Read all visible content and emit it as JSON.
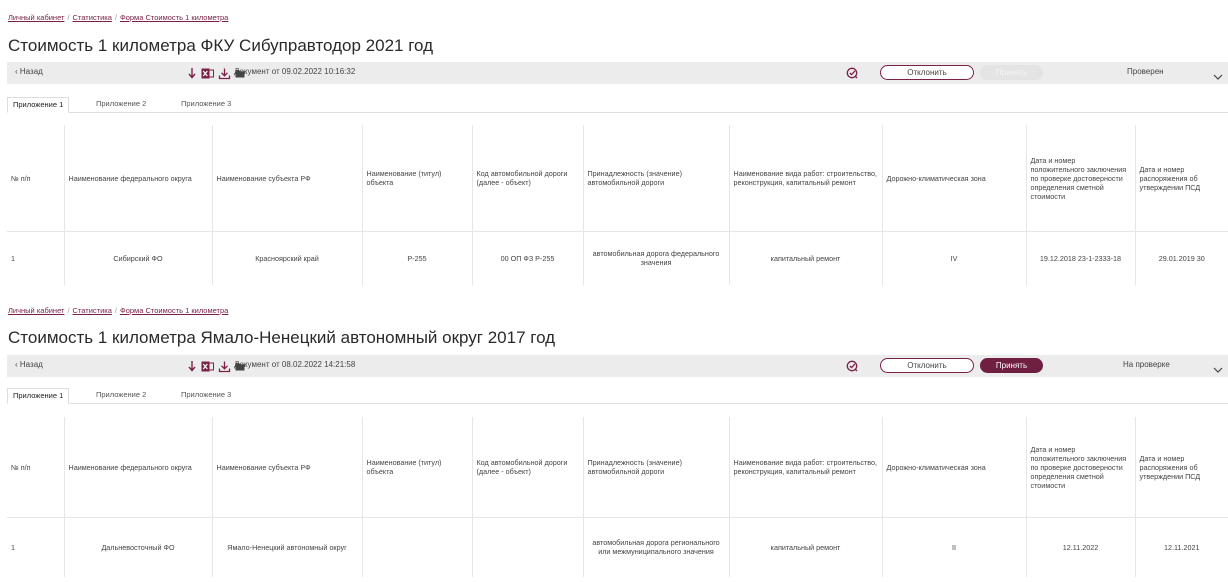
{
  "breadcrumb": {
    "home": "Личный кабинет",
    "stats": "Статистика",
    "form": "Форма Стоимость 1 километра",
    "separator": "/"
  },
  "toolbar": {
    "back_label": "‹ Назад",
    "reject_label": "Отклонить",
    "accept_label": "Принять"
  },
  "tabs": [
    "Приложение 1",
    "Приложение 2",
    "Приложение 3"
  ],
  "columns": [
    "№ п/п",
    "Наименование федерального округа",
    "Наименование субъекта РФ",
    "Наименование (титул) объекта",
    "Код автомобильной дороги (далее - объект)",
    "Принадлежность (значение) автомобильной дороги",
    "Наименование вида работ: строительство, реконструкция, капитальный ремонт",
    "Дорожно-климатическая зона",
    "Дата и номер положительного заключения по проверке достоверности определения сметной стоимости",
    "Дата и номер распоряжения об утверждении ПСД"
  ],
  "reports": [
    {
      "title": "Стоимость 1 километра ФКУ Сибуправтодор 2021 год",
      "document": "Документ от 09.02.2022 10:16:32",
      "status": "Проверен",
      "row": [
        "1",
        "Сибирский ФО",
        "Красноярский край",
        "Р-255",
        "00 ОП ФЗ Р-255",
        "автомобильная дорога федерального значения",
        "капитальный ремонт",
        "IV",
        "19.12.2018 23-1-2333-18",
        "29.01.2019 30"
      ]
    },
    {
      "title": "Стоимость 1 километра Ямало-Ненецкий автономный округ 2017 год",
      "document": "Документ от 08.02.2022 14:21:58",
      "status": "На проверке",
      "row": [
        "1",
        "Дальневосточный ФО",
        "Ямало-Ненецкий автономный округ",
        "",
        "",
        "автомобильная дорога регионального или межмуниципального значения",
        "капитальный ремонт",
        "II",
        "12.11.2022",
        "12.11.2021"
      ]
    }
  ],
  "colors": {
    "accent": "#7b2148",
    "accept_active": "#6f1f42",
    "toolbar_bg": "#ececec",
    "excel_icon": "#7b2148"
  },
  "icons": [
    "sort-down-icon",
    "excel-icon",
    "download-icon",
    "folder-icon",
    "check-badge-icon",
    "chevron-down-icon"
  ]
}
